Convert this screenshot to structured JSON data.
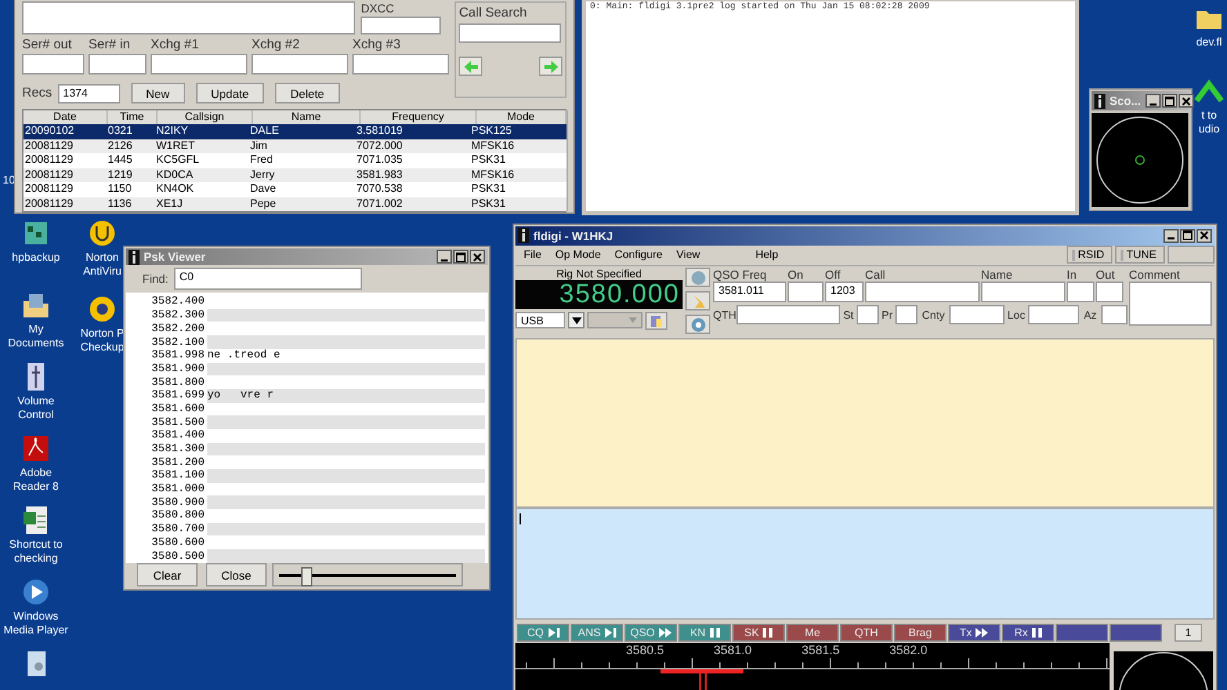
{
  "logbook": {
    "dxcc_label": "DXCC",
    "call_search_label": "Call Search",
    "exchange_labels": [
      "Ser# out",
      "Ser# in",
      "Xchg #1",
      "Xchg #2",
      "Xchg #3"
    ],
    "recs_label": "Recs",
    "recs_value": "1374",
    "buttons": [
      "New",
      "Update",
      "Delete"
    ],
    "table": {
      "columns": [
        "Date",
        "Time",
        "Callsign",
        "Name",
        "Frequency",
        "Mode"
      ],
      "rows": [
        {
          "cells": [
            "20090102",
            "0321",
            "N2IKY",
            "DALE",
            "3.581019",
            "PSK125"
          ],
          "selected": true
        },
        {
          "cells": [
            "20081129",
            "2126",
            "W1RET",
            "Jim",
            "7072.000",
            "MFSK16"
          ],
          "selected": false
        },
        {
          "cells": [
            "20081129",
            "1445",
            "KC5GFL",
            "Fred",
            "7071.035",
            "PSK31"
          ],
          "selected": false
        },
        {
          "cells": [
            "20081129",
            "1219",
            "KD0CA",
            "Jerry",
            "3581.983",
            "MFSK16"
          ],
          "selected": false
        },
        {
          "cells": [
            "20081129",
            "1150",
            "KN4OK",
            "Dave",
            "7070.538",
            "PSK31"
          ],
          "selected": false
        },
        {
          "cells": [
            "20081129",
            "1136",
            "XE1J",
            "Pepe",
            "7071.002",
            "PSK31"
          ],
          "selected": false
        }
      ]
    }
  },
  "event_log": {
    "lines": [
      "0: Main: fldigi 3.1pre2 log started on Thu Jan 15 08:02:28 2009"
    ]
  },
  "desktop_icons": [
    {
      "label": "hpbackup",
      "kind": "backup"
    },
    {
      "label": "My Documents",
      "kind": "documents"
    },
    {
      "label": "Volume Control",
      "kind": "volume"
    },
    {
      "label": "Adobe Reader 8",
      "kind": "reader"
    },
    {
      "label": "Shortcut to checking",
      "kind": "sheet"
    },
    {
      "label": "Windows Media Player",
      "kind": "media"
    },
    {
      "kind": "file"
    }
  ],
  "desktop_icons_2": [
    {
      "label": "Norton AntiViru",
      "kind": "norton"
    },
    {
      "label": "Norton P Checkup",
      "kind": "norton2"
    }
  ],
  "desktop_icons_right": [
    {
      "label": "dev.fl",
      "kind": "folder"
    },
    {
      "label": "t to udio",
      "kind": "arrow"
    }
  ],
  "cut_label": "10",
  "scope_window": {
    "title": "Sco..."
  },
  "psk_viewer": {
    "title": "Psk Viewer",
    "find_label": "Find:",
    "find_value": "C0",
    "rows": [
      {
        "freq": "3582.400"
      },
      {
        "freq": "3582.300"
      },
      {
        "freq": "3582.200"
      },
      {
        "freq": "3582.100"
      },
      {
        "freq": "3581.998",
        "text": "ne .treod e"
      },
      {
        "freq": "3581.900"
      },
      {
        "freq": "3581.800"
      },
      {
        "freq": "3581.699",
        "text": "yo   vre r"
      },
      {
        "freq": "3581.600"
      },
      {
        "freq": "3581.500"
      },
      {
        "freq": "3581.400"
      },
      {
        "freq": "3581.300"
      },
      {
        "freq": "3581.200"
      },
      {
        "freq": "3581.100"
      },
      {
        "freq": "3581.000"
      },
      {
        "freq": "3580.900"
      },
      {
        "freq": "3580.800"
      },
      {
        "freq": "3580.700"
      },
      {
        "freq": "3580.600"
      },
      {
        "freq": "3580.500"
      }
    ],
    "buttons": [
      "Clear",
      "Close"
    ],
    "slider": {
      "level": 0.15
    }
  },
  "fldigi": {
    "title": "fldigi - W1HKJ",
    "menu": [
      "File",
      "Op Mode",
      "Configure",
      "View",
      "Help"
    ],
    "toggles": [
      {
        "label": "RSID",
        "checked": false
      },
      {
        "label": "TUNE",
        "checked": false
      }
    ],
    "rig_label": "Rig Not Specified",
    "frequency": "3580.000",
    "mode": "USB",
    "qso_fields": [
      {
        "label": "QSO Freq",
        "value": "3581.011"
      },
      {
        "label": "On"
      },
      {
        "label": "Off",
        "value": "1203"
      },
      {
        "label": "Call"
      },
      {
        "label": "Name"
      },
      {
        "label": "In"
      },
      {
        "label": "Out"
      },
      {
        "label": "Comment"
      }
    ],
    "location_fields": [
      {
        "label": "QTH"
      },
      {
        "label": "St"
      },
      {
        "label": "Pr"
      },
      {
        "label": "Cnty"
      },
      {
        "label": "Loc"
      },
      {
        "label": "Az"
      }
    ],
    "macros": [
      {
        "label": "CQ",
        "kind": "skip",
        "color": "#3f8f8c"
      },
      {
        "label": "ANS",
        "kind": "skip",
        "color": "#3f8f8c"
      },
      {
        "label": "QSO",
        "kind": "forward",
        "color": "#3f8f8c"
      },
      {
        "label": "KN",
        "kind": "pause",
        "color": "#3f8f8c"
      },
      {
        "label": "SK",
        "kind": "pause",
        "color": "#9a4a4a"
      },
      {
        "label": "Me",
        "kind": "plain",
        "color": "#9a4a4a"
      },
      {
        "label": "QTH",
        "kind": "plain",
        "color": "#9a4a4a"
      },
      {
        "label": "Brag",
        "kind": "plain",
        "color": "#9a4a4a"
      },
      {
        "label": "Tx",
        "kind": "forward",
        "color": "#4a4a9a"
      },
      {
        "label": "Rx",
        "kind": "pause",
        "color": "#4a4a9a"
      },
      {
        "kind": "plain",
        "color": "#4a4a9a"
      },
      {
        "kind": "plain",
        "color": "#4a4a9a"
      }
    ],
    "macro_page": "1",
    "scale_labels": [
      "3580.5",
      "3581.0",
      "3581.5",
      "3582.0"
    ]
  }
}
